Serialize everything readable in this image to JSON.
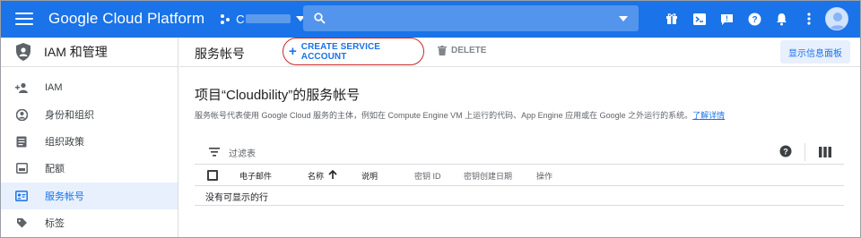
{
  "topbar": {
    "brand": "Google Cloud Platform",
    "project_name": "C",
    "icons": [
      "menu-icon",
      "project-icon",
      "search-icon",
      "gift-icon",
      "cloud-shell-icon",
      "support-icon",
      "help-icon",
      "notifications-icon",
      "more-icon",
      "avatar"
    ]
  },
  "sidebar": {
    "title": "IAM 和管理",
    "items": [
      {
        "label": "IAM",
        "icon": "person-add-icon",
        "active": false
      },
      {
        "label": "身份和组织",
        "icon": "account-circle-icon",
        "active": false
      },
      {
        "label": "组织政策",
        "icon": "list-icon",
        "active": false
      },
      {
        "label": "配额",
        "icon": "quota-icon",
        "active": false
      },
      {
        "label": "服务帐号",
        "icon": "service-account-icon",
        "active": true
      },
      {
        "label": "标签",
        "icon": "tag-icon",
        "active": false
      }
    ]
  },
  "header": {
    "title": "服务帐号",
    "create_label": "CREATE SERVICE ACCOUNT",
    "delete_label": "DELETE",
    "info_panel_label": "显示信息面板"
  },
  "content": {
    "section_title": "项目“Cloudbility”的服务帐号",
    "description": "服务帐号代表使用 Google Cloud 服务的主体，例如在 Compute Engine VM 上运行的代码、App Engine 应用或在 Google 之外运行的系统。",
    "learn_more": "了解详情"
  },
  "table": {
    "filter_label": "过滤表",
    "columns": [
      "电子邮件",
      "名称",
      "说明",
      "密钥 ID",
      "密钥创建日期",
      "操作"
    ],
    "empty_text": "没有可显示的行"
  },
  "colors": {
    "primary": "#1a73e8",
    "highlight_ring": "#c62828",
    "active_bg": "#e8f0fe"
  }
}
